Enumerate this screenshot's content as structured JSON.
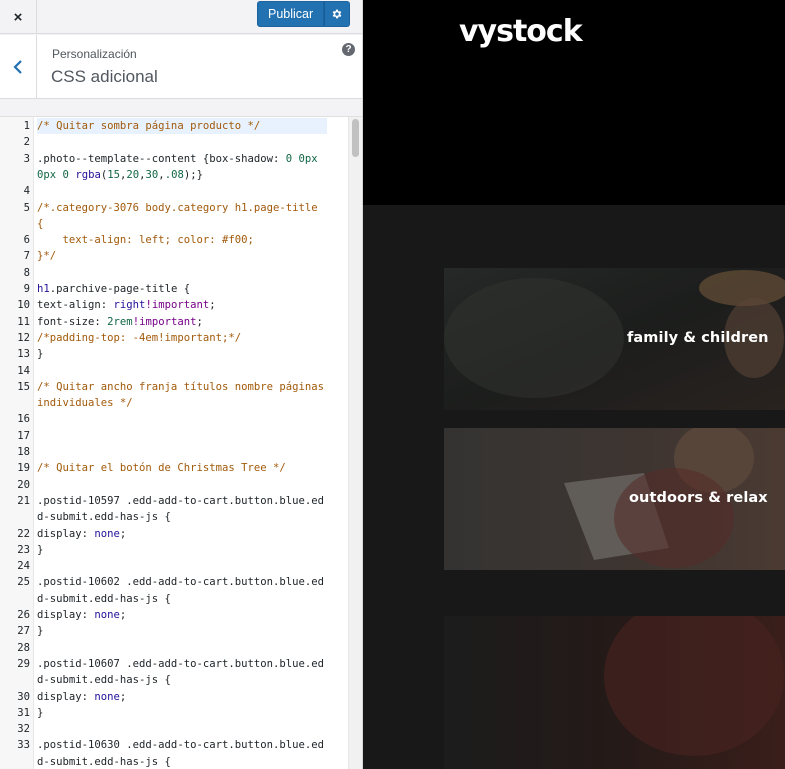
{
  "topbar": {
    "close_icon": "×",
    "publish_label": "Publicar",
    "settings_icon": "gear-icon"
  },
  "section": {
    "parent": "Personalización",
    "title": "CSS adicional",
    "back_icon": "chevron-left-icon",
    "help_icon": "?"
  },
  "editor": {
    "lines": [
      {
        "n": "1",
        "segments": [
          {
            "t": "/* Quitar sombra página producto */",
            "c": "comment"
          }
        ],
        "rows": 1
      },
      {
        "n": "2",
        "segments": [],
        "rows": 1
      },
      {
        "n": "3",
        "segments": [
          {
            "t": ".photo--template--content {box-shadow: "
          },
          {
            "t": "0",
            "c": "num"
          },
          {
            "t": " "
          },
          {
            "t": "0px",
            "c": "num"
          },
          {
            "t": " "
          },
          {
            "t": "0px",
            "c": "num"
          },
          {
            "t": " "
          },
          {
            "t": "0",
            "c": "num"
          },
          {
            "t": " "
          },
          {
            "t": "rgba",
            "c": "kw"
          },
          {
            "t": "("
          },
          {
            "t": "15",
            "c": "num"
          },
          {
            "t": ","
          },
          {
            "t": "20",
            "c": "num"
          },
          {
            "t": ","
          },
          {
            "t": "30",
            "c": "num"
          },
          {
            "t": ","
          },
          {
            "t": ".08",
            "c": "num"
          },
          {
            "t": ");}"
          }
        ],
        "rows": 2
      },
      {
        "n": "4",
        "segments": [],
        "rows": 1
      },
      {
        "n": "5",
        "segments": [
          {
            "t": "/*.category-3076 body.category h1.page-title {",
            "c": "comment"
          }
        ],
        "rows": 2
      },
      {
        "n": "6",
        "segments": [
          {
            "t": "    text-align: left; color: #f00;",
            "c": "comment"
          }
        ],
        "rows": 1
      },
      {
        "n": "7",
        "segments": [
          {
            "t": "}*/",
            "c": "comment"
          }
        ],
        "rows": 1
      },
      {
        "n": "8",
        "segments": [],
        "rows": 1
      },
      {
        "n": "9",
        "segments": [
          {
            "t": "h1",
            "c": "kw"
          },
          {
            "t": ".parchive-page-title {"
          }
        ],
        "rows": 1
      },
      {
        "n": "10",
        "segments": [
          {
            "t": "text-align: "
          },
          {
            "t": "right",
            "c": "kw"
          },
          {
            "t": "!important",
            "c": "imp"
          },
          {
            "t": ";"
          }
        ],
        "rows": 1
      },
      {
        "n": "11",
        "segments": [
          {
            "t": "font-size: "
          },
          {
            "t": "2rem",
            "c": "num"
          },
          {
            "t": "!important",
            "c": "imp"
          },
          {
            "t": ";"
          }
        ],
        "rows": 1
      },
      {
        "n": "12",
        "segments": [
          {
            "t": "/*padding-top: -4em!important;*/",
            "c": "comment"
          }
        ],
        "rows": 1
      },
      {
        "n": "13",
        "segments": [
          {
            "t": "}"
          }
        ],
        "rows": 1
      },
      {
        "n": "14",
        "segments": [],
        "rows": 1
      },
      {
        "n": "15",
        "segments": [
          {
            "t": "/* Quitar ancho franja títulos nombre páginas individuales */",
            "c": "comment"
          }
        ],
        "rows": 2
      },
      {
        "n": "16",
        "segments": [],
        "rows": 1
      },
      {
        "n": "17",
        "segments": [],
        "rows": 1
      },
      {
        "n": "18",
        "segments": [],
        "rows": 1
      },
      {
        "n": "19",
        "segments": [
          {
            "t": "/* Quitar el botón de Christmas Tree */",
            "c": "comment"
          }
        ],
        "rows": 1
      },
      {
        "n": "20",
        "segments": [],
        "rows": 1
      },
      {
        "n": "21",
        "segments": [
          {
            "t": ".postid-10597 .edd-add-to-cart.button.blue.edd-submit.edd-has-js {"
          }
        ],
        "rows": 2
      },
      {
        "n": "22",
        "segments": [
          {
            "t": "display: "
          },
          {
            "t": "none",
            "c": "kw"
          },
          {
            "t": ";"
          }
        ],
        "rows": 1
      },
      {
        "n": "23",
        "segments": [
          {
            "t": "}"
          }
        ],
        "rows": 1
      },
      {
        "n": "24",
        "segments": [],
        "rows": 1
      },
      {
        "n": "25",
        "segments": [
          {
            "t": ".postid-10602 .edd-add-to-cart.button.blue.edd-submit.edd-has-js {"
          }
        ],
        "rows": 2
      },
      {
        "n": "26",
        "segments": [
          {
            "t": "display: "
          },
          {
            "t": "none",
            "c": "kw"
          },
          {
            "t": ";"
          }
        ],
        "rows": 1
      },
      {
        "n": "27",
        "segments": [
          {
            "t": "}"
          }
        ],
        "rows": 1
      },
      {
        "n": "28",
        "segments": [],
        "rows": 1
      },
      {
        "n": "29",
        "segments": [
          {
            "t": ".postid-10607 .edd-add-to-cart.button.blue.edd-submit.edd-has-js {"
          }
        ],
        "rows": 2
      },
      {
        "n": "30",
        "segments": [
          {
            "t": "display: "
          },
          {
            "t": "none",
            "c": "kw"
          },
          {
            "t": ";"
          }
        ],
        "rows": 1
      },
      {
        "n": "31",
        "segments": [
          {
            "t": "}"
          }
        ],
        "rows": 1
      },
      {
        "n": "32",
        "segments": [],
        "rows": 1
      },
      {
        "n": "33",
        "segments": [
          {
            "t": ".postid-10630 .edd-add-to-cart.button.blue.edd-submit.edd-has-js {"
          }
        ],
        "rows": 2
      }
    ]
  },
  "preview": {
    "logo": "vystock",
    "tiles": [
      {
        "label": "family & children"
      },
      {
        "label": "outdoors & relax"
      },
      {
        "label": ""
      }
    ]
  },
  "colors": {
    "publish_blue": "#2271b1",
    "comment": "#a25a0b",
    "number": "#116644",
    "keyword": "#221199",
    "important": "#770088",
    "logo_accent": "#e13a3a"
  }
}
